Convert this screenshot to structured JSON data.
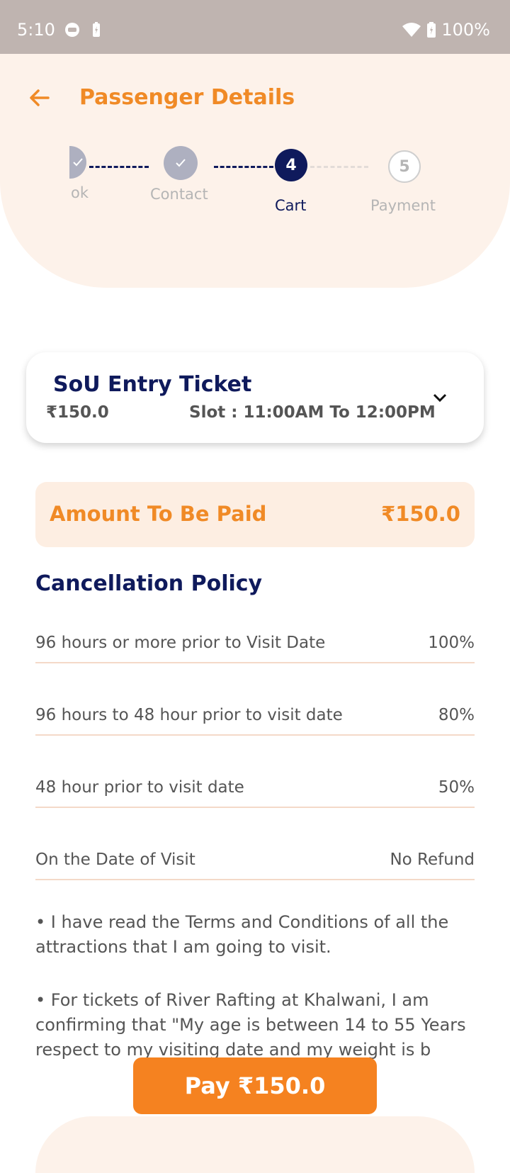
{
  "status_bar": {
    "time": "5:10",
    "battery": "100%"
  },
  "header": {
    "title": "Passenger Details"
  },
  "stepper": {
    "steps": [
      {
        "label": "ok",
        "state": "done"
      },
      {
        "label": "Contact",
        "state": "done"
      },
      {
        "number": "4",
        "label": "Cart",
        "state": "current"
      },
      {
        "number": "5",
        "label": "Payment",
        "state": "pending"
      }
    ]
  },
  "ticket_card": {
    "title": "SoU Entry Ticket",
    "price": "₹150.0",
    "slot": "Slot : 11:00AM To 12:00PM"
  },
  "amount": {
    "label": "Amount To Be Paid",
    "value": "₹150.0"
  },
  "cancellation": {
    "title": "Cancellation Policy",
    "rows": [
      {
        "text": "96 hours or more prior to Visit Date",
        "value": "100%"
      },
      {
        "text": "96 hours to 48 hour prior to visit date",
        "value": "80%"
      },
      {
        "text": "48 hour prior to visit date",
        "value": "50%"
      },
      {
        "text": "On the Date of Visit",
        "value": "No Refund"
      }
    ]
  },
  "terms": [
    "• I have read the Terms and Conditions of all the attractions that I am going to visit.",
    "• For tickets of River Rafting at Khalwani, I am confirming that \"My age is between 14 to 55 Years respect to my visiting date and my weight is b"
  ],
  "pay_button": {
    "label": "Pay ₹150.0"
  },
  "colors": {
    "accent": "#f08a26",
    "navy": "#0f1a5c",
    "cream": "#fdf2ea"
  }
}
